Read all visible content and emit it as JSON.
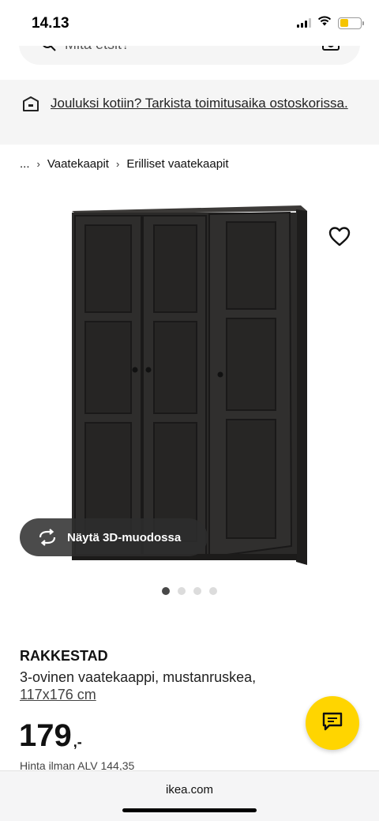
{
  "status_bar": {
    "time": "14.13",
    "battery_level": 0.4,
    "battery_color": "#f5c400"
  },
  "search": {
    "placeholder": "Mitä etsit?",
    "icon": "search-icon",
    "camera_icon": "camera-icon"
  },
  "notice": {
    "icon": "delivery-box-icon",
    "text": "Jouluksi kotiin? Tarkista toimitusaika ostoskorissa."
  },
  "breadcrumb": {
    "items": [
      "...",
      "Vaatekaapit",
      "Erilliset vaatekaapit"
    ],
    "separator": "›"
  },
  "gallery": {
    "image": "wardrobe-product-image",
    "favorite_icon": "heart-icon",
    "view_3d_label": "Näytä 3D-muodossa",
    "view_3d_icon": "rotate-3d-icon",
    "slide_count": 4,
    "active_slide": 1
  },
  "product": {
    "name": "RAKKESTAD",
    "description": "3-ovinen vaatekaappi, mustanruskea,",
    "size": "117x176 cm",
    "price": "179",
    "price_suffix": ",-",
    "price_ex_vat": "Hinta ilman ALV 144,35"
  },
  "chat": {
    "icon": "chat-icon",
    "color": "#ffd500"
  },
  "browser": {
    "url": "ikea.com"
  }
}
